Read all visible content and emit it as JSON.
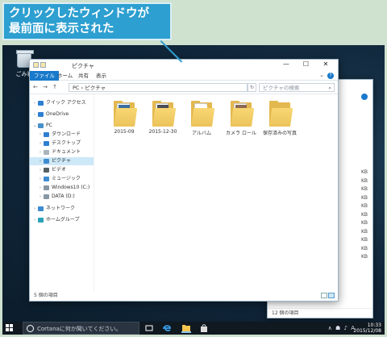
{
  "callout": {
    "line1": "クリックしたウィンドウが",
    "line2": "最前面に表示された"
  },
  "desktop": {
    "recycle_bin_label": "ごみ箱"
  },
  "window": {
    "title": "ピクチャ",
    "controls": {
      "minimize": "—",
      "maximize": "☐",
      "close": "✕"
    },
    "ribbon_tabs": [
      "ファイル",
      "ホーム",
      "共有",
      "表示"
    ],
    "nav_buttons": "← → ↑",
    "address_path": "PC › ピクチャ",
    "search_placeholder": "ピクチャの検索",
    "nav_pane": [
      {
        "label": "クイック アクセス",
        "icon": "star-icon",
        "color": "#2f7fd1"
      },
      {
        "label": "OneDrive",
        "icon": "cloud-icon",
        "color": "#2f7fd1"
      },
      {
        "label": "PC",
        "icon": "computer-icon",
        "color": "#4a90c8"
      },
      {
        "label": "ダウンロード",
        "icon": "download-icon",
        "color": "#2f7fd1"
      },
      {
        "label": "デスクトップ",
        "icon": "desktop-icon",
        "color": "#2f7fd1"
      },
      {
        "label": "ドキュメント",
        "icon": "document-icon",
        "color": "#aab4bb"
      },
      {
        "label": "ピクチャ",
        "icon": "pictures-icon",
        "color": "#3d8bd0"
      },
      {
        "label": "ビデオ",
        "icon": "video-icon",
        "color": "#555f66"
      },
      {
        "label": "ミュージック",
        "icon": "music-icon",
        "color": "#3d8bd0"
      },
      {
        "label": "Windows10 (C:)",
        "icon": "drive-icon",
        "color": "#8796a2"
      },
      {
        "label": "DATA (D:)",
        "icon": "drive-icon",
        "color": "#8796a2"
      },
      {
        "label": "ネットワーク",
        "icon": "network-icon",
        "color": "#3d8bd0"
      },
      {
        "label": "ホームグループ",
        "icon": "homegroup-icon",
        "color": "#2aa1b8"
      }
    ],
    "folders": [
      {
        "label": "2015-09",
        "photo_color": "#3b6e9e"
      },
      {
        "label": "2015-12-30",
        "photo_color": "#4a4e55"
      },
      {
        "label": "アルバム",
        "photo_color": "#ffffff"
      },
      {
        "label": "カメラ ロール",
        "photo_color": "#8c6a52"
      },
      {
        "label": "保存済みの写真",
        "photo_color": ""
      }
    ],
    "status_text": "5 個の項目"
  },
  "bg_window": {
    "sizes": [
      "KB",
      "KB",
      "KB",
      "KB",
      "KB",
      "KB",
      "KB",
      "KB",
      "KB",
      "KB",
      "KB"
    ],
    "status_text": "12 個の項目"
  },
  "taskbar": {
    "cortana_placeholder": "Cortanaに何か聞いてください。",
    "time": "10:33",
    "date": "2015/12/08",
    "ime": "A"
  },
  "colors": {
    "accent": "#1979ca",
    "callout": "#2d9fd0",
    "folder": "#e3b84f"
  }
}
